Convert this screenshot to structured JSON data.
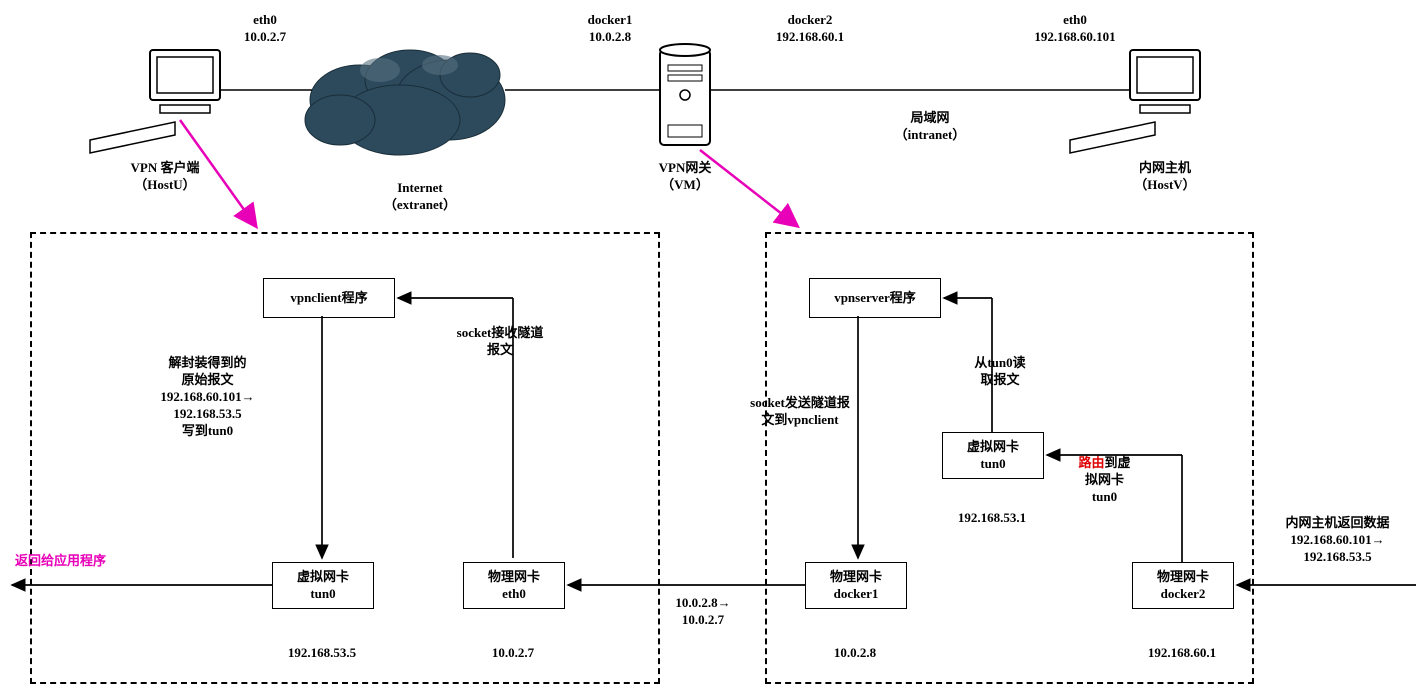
{
  "top": {
    "hostU": {
      "if": "eth0",
      "ip": "10.0.2.7",
      "name1": "VPN 客户端",
      "name2": "（HostU）"
    },
    "internet": {
      "name1": "Internet",
      "name2": "（extranet）"
    },
    "gw": {
      "if1": "docker1",
      "ip1": "10.0.2.8",
      "if2": "docker2",
      "ip2": "192.168.60.1",
      "name1": "VPN网关",
      "name2": "（VM）"
    },
    "intranet": {
      "name1": "局域网",
      "name2": "（intranet）"
    },
    "hostV": {
      "if": "eth0",
      "ip": "192.168.60.101",
      "name1": "内网主机",
      "name2": "（HostV）"
    }
  },
  "left": {
    "proc": "vpnclient程序",
    "unpack1": "解封装得到的",
    "unpack2": "原始报文",
    "unpack3": "192.168.60.101→",
    "unpack4": "192.168.53.5",
    "unpack5": "写到tun0",
    "sockrecv1": "socket接收隧道",
    "sockrecv2": "报文",
    "tun_name": "虚拟网卡",
    "tun_if": "tun0",
    "tun_ip": "192.168.53.5",
    "eth_name": "物理网卡",
    "eth_if": "eth0",
    "eth_ip": "10.0.2.7",
    "ret": "返回给应用程序"
  },
  "mid": {
    "link1": "10.0.2.8→",
    "link2": "10.0.2.7"
  },
  "right": {
    "proc": "vpnserver程序",
    "socksend1": "socket发送隧道报",
    "socksend2": "文到vpnclient",
    "read1": "从tun0读",
    "read2": "取报文",
    "tun_name": "虚拟网卡",
    "tun_if": "tun0",
    "tun_ip": "192.168.53.1",
    "route1": "路由",
    "route2": "到虚",
    "route3": "拟网卡",
    "route4": "tun0",
    "d1_name": "物理网卡",
    "d1_if": "docker1",
    "d1_ip": "10.0.2.8",
    "d2_name": "物理网卡",
    "d2_if": "docker2",
    "d2_ip": "192.168.60.1",
    "in1": "内网主机返回数据",
    "in2": "192.168.60.101→",
    "in3": "192.168.53.5"
  }
}
